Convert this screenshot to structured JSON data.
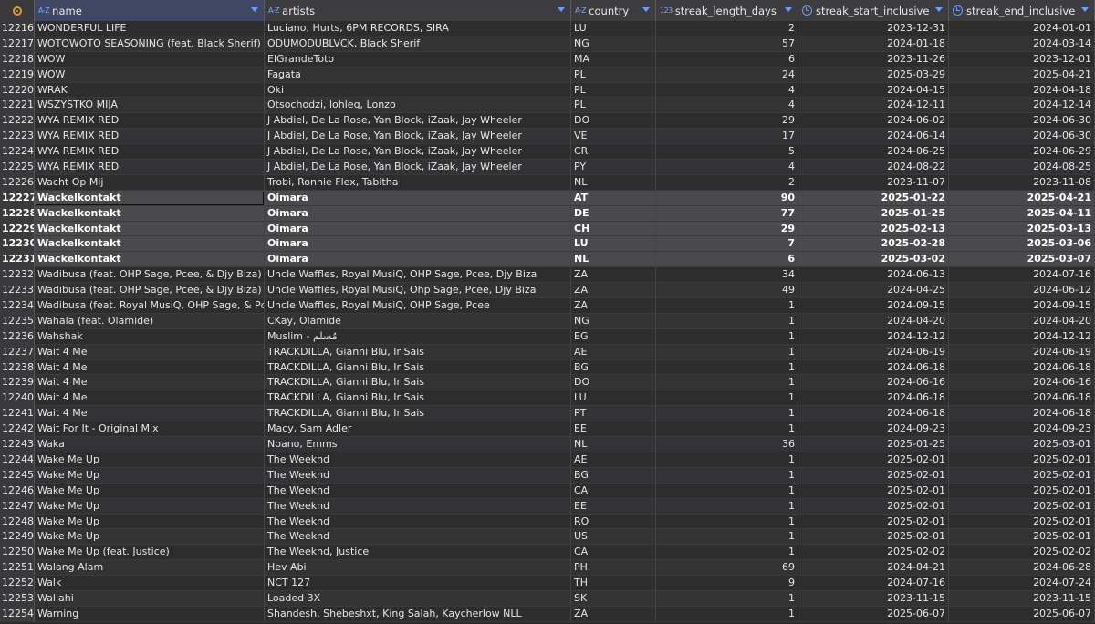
{
  "grid": {
    "columns": [
      {
        "key": "name",
        "label": "name",
        "type_icon": "text-type-icon"
      },
      {
        "key": "artists",
        "label": "artists",
        "type_icon": "text-type-icon"
      },
      {
        "key": "country",
        "label": "country",
        "type_icon": "text-type-icon"
      },
      {
        "key": "streak_length_days",
        "label": "streak_length_days",
        "type_icon": "number-type-icon"
      },
      {
        "key": "streak_start_inclusive",
        "label": "streak_start_inclusive",
        "type_icon": "date-type-icon"
      },
      {
        "key": "streak_end_inclusive",
        "label": "streak_end_inclusive",
        "type_icon": "date-type-icon"
      }
    ],
    "text_type_glyph": "A-Z",
    "number_type_glyph": "123",
    "colors": {
      "accent": "#6b9cff",
      "header_border": "#c8463f",
      "settings": "#e09a2d"
    },
    "selected_rows": [
      "12227",
      "12228",
      "12229",
      "12230",
      "12231"
    ],
    "active_cell": {
      "row": "12227",
      "column": "name"
    },
    "rows": [
      {
        "n": "12216",
        "name": "WONDERFUL LIFE",
        "artists": "Luciano, Hurts, 6PM RECORDS, SIRA",
        "country": "LU",
        "len": "2",
        "start": "2023-12-31",
        "end": "2024-01-01"
      },
      {
        "n": "12217",
        "name": "WOTOWOTO SEASONING (feat. Black Sherif)",
        "artists": "ODUMODUBLVCK, Black Sherif",
        "country": "NG",
        "len": "57",
        "start": "2024-01-18",
        "end": "2024-03-14"
      },
      {
        "n": "12218",
        "name": "WOW",
        "artists": "ElGrandeToto",
        "country": "MA",
        "len": "6",
        "start": "2023-11-26",
        "end": "2023-12-01"
      },
      {
        "n": "12219",
        "name": "WOW",
        "artists": "Fagata",
        "country": "PL",
        "len": "24",
        "start": "2025-03-29",
        "end": "2025-04-21"
      },
      {
        "n": "12220",
        "name": "WRAK",
        "artists": "Oki",
        "country": "PL",
        "len": "4",
        "start": "2024-04-15",
        "end": "2024-04-18"
      },
      {
        "n": "12221",
        "name": "WSZYSTKO MIJA",
        "artists": "Otsochodzi, lohleq, Lonzo",
        "country": "PL",
        "len": "4",
        "start": "2024-12-11",
        "end": "2024-12-14"
      },
      {
        "n": "12222",
        "name": "WYA REMIX RED",
        "artists": "J Abdiel, De La Rose, Yan Block, iZaak, Jay Wheeler",
        "country": "DO",
        "len": "29",
        "start": "2024-06-02",
        "end": "2024-06-30"
      },
      {
        "n": "12223",
        "name": "WYA REMIX RED",
        "artists": "J Abdiel, De La Rose, Yan Block, iZaak, Jay Wheeler",
        "country": "VE",
        "len": "17",
        "start": "2024-06-14",
        "end": "2024-06-30"
      },
      {
        "n": "12224",
        "name": "WYA REMIX RED",
        "artists": "J Abdiel, De La Rose, Yan Block, iZaak, Jay Wheeler",
        "country": "CR",
        "len": "5",
        "start": "2024-06-25",
        "end": "2024-06-29"
      },
      {
        "n": "12225",
        "name": "WYA REMIX RED",
        "artists": "J Abdiel, De La Rose, Yan Block, iZaak, Jay Wheeler",
        "country": "PY",
        "len": "4",
        "start": "2024-08-22",
        "end": "2024-08-25"
      },
      {
        "n": "12226",
        "name": "Wacht Op Mij",
        "artists": "Trobi, Ronnie Flex, Tabitha",
        "country": "NL",
        "len": "2",
        "start": "2023-11-07",
        "end": "2023-11-08"
      },
      {
        "n": "12227",
        "name": "Wackelkontakt",
        "artists": "Oimara",
        "country": "AT",
        "len": "90",
        "start": "2025-01-22",
        "end": "2025-04-21"
      },
      {
        "n": "12228",
        "name": "Wackelkontakt",
        "artists": "Oimara",
        "country": "DE",
        "len": "77",
        "start": "2025-01-25",
        "end": "2025-04-11"
      },
      {
        "n": "12229",
        "name": "Wackelkontakt",
        "artists": "Oimara",
        "country": "CH",
        "len": "29",
        "start": "2025-02-13",
        "end": "2025-03-13"
      },
      {
        "n": "12230",
        "name": "Wackelkontakt",
        "artists": "Oimara",
        "country": "LU",
        "len": "7",
        "start": "2025-02-28",
        "end": "2025-03-06"
      },
      {
        "n": "12231",
        "name": "Wackelkontakt",
        "artists": "Oimara",
        "country": "NL",
        "len": "6",
        "start": "2025-03-02",
        "end": "2025-03-07"
      },
      {
        "n": "12232",
        "name": "Wadibusa (feat. OHP Sage, Pcee, & Djy Biza)",
        "artists": "Uncle Waffles, Royal MusiQ, OHP Sage, Pcee, Djy Biza",
        "country": "ZA",
        "len": "34",
        "start": "2024-06-13",
        "end": "2024-07-16"
      },
      {
        "n": "12233",
        "name": "Wadibusa (feat. OHP Sage, Pcee, & Djy Biza)",
        "artists": "Uncle Waffles, Royal MusiQ, Ohp Sage, Pcee, Djy Biza",
        "country": "ZA",
        "len": "49",
        "start": "2024-04-25",
        "end": "2024-06-12"
      },
      {
        "n": "12234",
        "name": "Wadibusa (feat. Royal MusiQ, OHP Sage, & Pcee",
        "artists": "Uncle Waffles, Royal MusiQ, OHP Sage, Pcee",
        "country": "ZA",
        "len": "1",
        "start": "2024-09-15",
        "end": "2024-09-15"
      },
      {
        "n": "12235",
        "name": "Wahala (feat. Olamide)",
        "artists": "CKay, Olamide",
        "country": "NG",
        "len": "1",
        "start": "2024-04-20",
        "end": "2024-04-20"
      },
      {
        "n": "12236",
        "name": "Wahshak",
        "artists": "Muslim - مُسلم",
        "country": "EG",
        "len": "1",
        "start": "2024-12-12",
        "end": "2024-12-12"
      },
      {
        "n": "12237",
        "name": "Wait 4 Me",
        "artists": "TRACKDILLA, Gianni Blu, Ir Sais",
        "country": "AE",
        "len": "1",
        "start": "2024-06-19",
        "end": "2024-06-19"
      },
      {
        "n": "12238",
        "name": "Wait 4 Me",
        "artists": "TRACKDILLA, Gianni Blu, Ir Sais",
        "country": "BG",
        "len": "1",
        "start": "2024-06-18",
        "end": "2024-06-18"
      },
      {
        "n": "12239",
        "name": "Wait 4 Me",
        "artists": "TRACKDILLA, Gianni Blu, Ir Sais",
        "country": "DO",
        "len": "1",
        "start": "2024-06-16",
        "end": "2024-06-16"
      },
      {
        "n": "12240",
        "name": "Wait 4 Me",
        "artists": "TRACKDILLA, Gianni Blu, Ir Sais",
        "country": "LU",
        "len": "1",
        "start": "2024-06-18",
        "end": "2024-06-18"
      },
      {
        "n": "12241",
        "name": "Wait 4 Me",
        "artists": "TRACKDILLA, Gianni Blu, Ir Sais",
        "country": "PT",
        "len": "1",
        "start": "2024-06-18",
        "end": "2024-06-18"
      },
      {
        "n": "12242",
        "name": "Wait For It - Original Mix",
        "artists": "Macy, Sam Adler",
        "country": "EE",
        "len": "1",
        "start": "2024-09-23",
        "end": "2024-09-23"
      },
      {
        "n": "12243",
        "name": "Waka",
        "artists": "Noano, Emms",
        "country": "NL",
        "len": "36",
        "start": "2025-01-25",
        "end": "2025-03-01"
      },
      {
        "n": "12244",
        "name": "Wake Me Up",
        "artists": "The Weeknd",
        "country": "AE",
        "len": "1",
        "start": "2025-02-01",
        "end": "2025-02-01"
      },
      {
        "n": "12245",
        "name": "Wake Me Up",
        "artists": "The Weeknd",
        "country": "BG",
        "len": "1",
        "start": "2025-02-01",
        "end": "2025-02-01"
      },
      {
        "n": "12246",
        "name": "Wake Me Up",
        "artists": "The Weeknd",
        "country": "CA",
        "len": "1",
        "start": "2025-02-01",
        "end": "2025-02-01"
      },
      {
        "n": "12247",
        "name": "Wake Me Up",
        "artists": "The Weeknd",
        "country": "EE",
        "len": "1",
        "start": "2025-02-01",
        "end": "2025-02-01"
      },
      {
        "n": "12248",
        "name": "Wake Me Up",
        "artists": "The Weeknd",
        "country": "RO",
        "len": "1",
        "start": "2025-02-01",
        "end": "2025-02-01"
      },
      {
        "n": "12249",
        "name": "Wake Me Up",
        "artists": "The Weeknd",
        "country": "US",
        "len": "1",
        "start": "2025-02-01",
        "end": "2025-02-01"
      },
      {
        "n": "12250",
        "name": "Wake Me Up (feat. Justice)",
        "artists": "The Weeknd, Justice",
        "country": "CA",
        "len": "1",
        "start": "2025-02-02",
        "end": "2025-02-02"
      },
      {
        "n": "12251",
        "name": "Walang Alam",
        "artists": "Hev Abi",
        "country": "PH",
        "len": "69",
        "start": "2024-04-21",
        "end": "2024-06-28"
      },
      {
        "n": "12252",
        "name": "Walk",
        "artists": "NCT 127",
        "country": "TH",
        "len": "9",
        "start": "2024-07-16",
        "end": "2024-07-24"
      },
      {
        "n": "12253",
        "name": "Wallahi",
        "artists": "Loaded 3X",
        "country": "SK",
        "len": "1",
        "start": "2023-11-15",
        "end": "2023-11-15"
      },
      {
        "n": "12254",
        "name": "Warning",
        "artists": "Shandesh, Shebeshxt, King Salah, Kaycherlow NLL",
        "country": "ZA",
        "len": "1",
        "start": "2025-06-07",
        "end": "2025-06-07"
      }
    ]
  }
}
